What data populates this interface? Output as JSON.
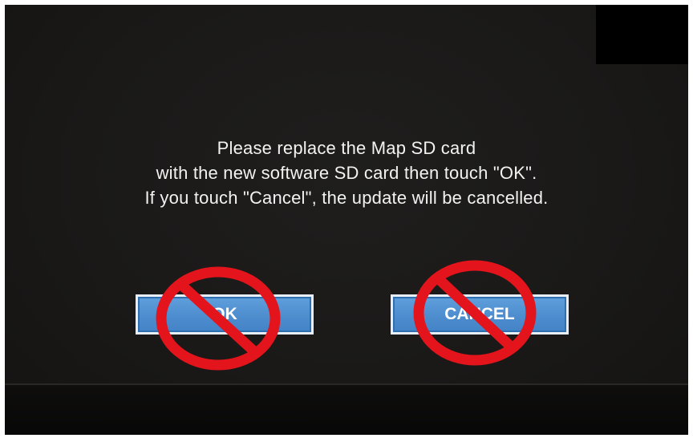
{
  "dialog": {
    "message_lines": [
      "Please replace the Map SD card",
      "with the new software SD card then touch \"OK\".",
      "If you touch \"Cancel\", the update will be cancelled."
    ]
  },
  "buttons": {
    "ok_label": "OK",
    "cancel_label": "CANCEL"
  },
  "colors": {
    "screen_background": "#1a1918",
    "button_fill": "#4f8fd0",
    "button_border": "#e8eef6",
    "prohibition_red": "#e3141b",
    "text": "#f2f2f2"
  },
  "icons": {
    "overlay": "prohibition-sign-icon"
  }
}
